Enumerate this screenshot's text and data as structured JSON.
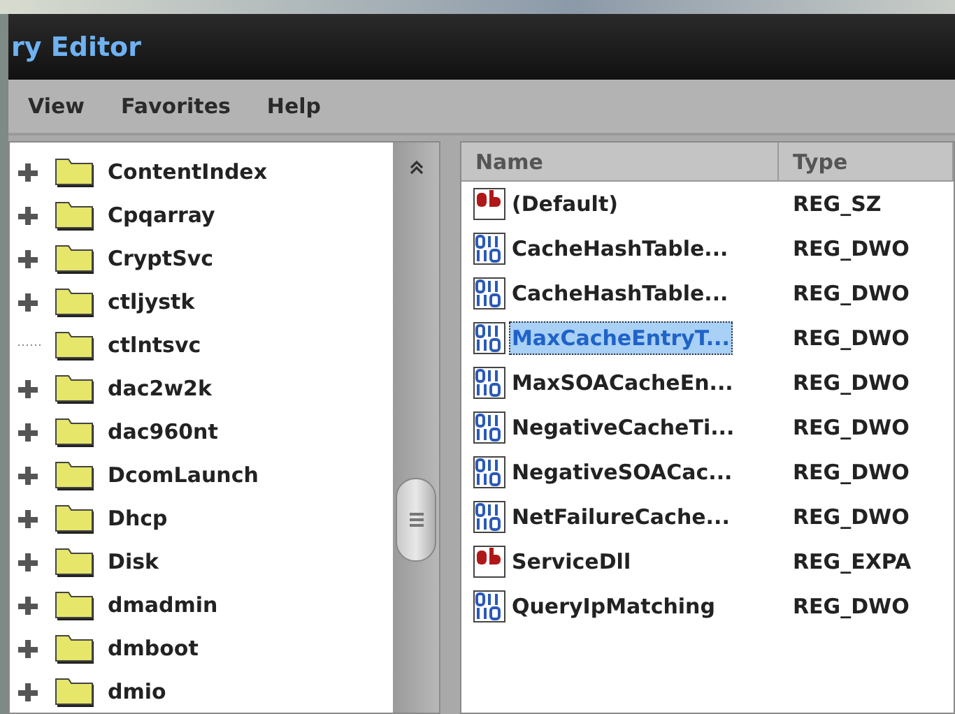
{
  "window": {
    "title": "ry Editor"
  },
  "menu": [
    "View",
    "Favorites",
    "Help"
  ],
  "tree": {
    "items": [
      {
        "label": "ContentIndex",
        "has_children": true
      },
      {
        "label": "Cpqarray",
        "has_children": true
      },
      {
        "label": "CryptSvc",
        "has_children": true
      },
      {
        "label": "ctljystk",
        "has_children": true
      },
      {
        "label": "ctlntsvc",
        "has_children": false
      },
      {
        "label": "dac2w2k",
        "has_children": true
      },
      {
        "label": "dac960nt",
        "has_children": true
      },
      {
        "label": "DcomLaunch",
        "has_children": true
      },
      {
        "label": "Dhcp",
        "has_children": true
      },
      {
        "label": "Disk",
        "has_children": true
      },
      {
        "label": "dmadmin",
        "has_children": true
      },
      {
        "label": "dmboot",
        "has_children": true
      },
      {
        "label": "dmio",
        "has_children": true
      }
    ]
  },
  "table": {
    "columns": [
      "Name",
      "Type"
    ],
    "rows": [
      {
        "kind": "string",
        "name": "(Default)",
        "type": "REG_SZ",
        "selected": false
      },
      {
        "kind": "binary",
        "name": "CacheHashTable...",
        "type": "REG_DWO",
        "selected": false
      },
      {
        "kind": "binary",
        "name": "CacheHashTable...",
        "type": "REG_DWO",
        "selected": false
      },
      {
        "kind": "binary",
        "name": "MaxCacheEntryT...",
        "type": "REG_DWO",
        "selected": true
      },
      {
        "kind": "binary",
        "name": "MaxSOACacheEn...",
        "type": "REG_DWO",
        "selected": false
      },
      {
        "kind": "binary",
        "name": "NegativeCacheTi...",
        "type": "REG_DWO",
        "selected": false
      },
      {
        "kind": "binary",
        "name": "NegativeSOACac...",
        "type": "REG_DWO",
        "selected": false
      },
      {
        "kind": "binary",
        "name": "NetFailureCache...",
        "type": "REG_DWO",
        "selected": false
      },
      {
        "kind": "string",
        "name": "ServiceDll",
        "type": "REG_EXPA",
        "selected": false
      },
      {
        "kind": "binary",
        "name": "QueryIpMatching",
        "type": "REG_DWO",
        "selected": false
      }
    ]
  }
}
